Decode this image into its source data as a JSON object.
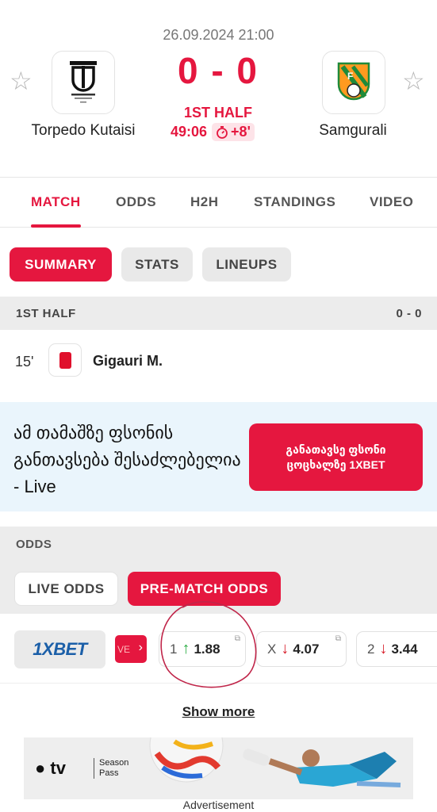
{
  "match": {
    "datetime": "26.09.2024 21:00",
    "home_team": "Torpedo Kutaisi",
    "away_team": "Samgurali",
    "score": "0 - 0",
    "period": "1ST HALF",
    "clock": "49:06",
    "added_time": "+8'"
  },
  "tabs": [
    "MATCH",
    "ODDS",
    "H2H",
    "STANDINGS",
    "VIDEO"
  ],
  "subtabs": [
    "SUMMARY",
    "STATS",
    "LINEUPS"
  ],
  "first_half": {
    "label": "1ST HALF",
    "score": "0 - 0"
  },
  "event": {
    "minute": "15'",
    "player": "Gigauri M.",
    "type": "red-card"
  },
  "promo": {
    "text": "ამ თამაშზე ფსონის განთავსება შესაძლებელია - Live",
    "cta": "განათავსე ფსონი ცოცხალზე 1XBET"
  },
  "odds": {
    "label": "ODDS",
    "toggle": [
      "LIVE ODDS",
      "PRE-MATCH ODDS"
    ],
    "bookmaker": "1XBET",
    "live_tag": "VE",
    "items": [
      {
        "label": "1",
        "value": "1.88",
        "direction": "up"
      },
      {
        "label": "X",
        "value": "4.07",
        "direction": "down"
      },
      {
        "label": "2",
        "value": "3.44",
        "direction": "down"
      }
    ],
    "show_more": "Show more"
  },
  "ad": {
    "label": "Advertisement",
    "brand": "tv",
    "sub": "Season Pass"
  },
  "colors": {
    "accent": "#e5173f",
    "up": "#2eae46",
    "down": "#d8202c"
  }
}
